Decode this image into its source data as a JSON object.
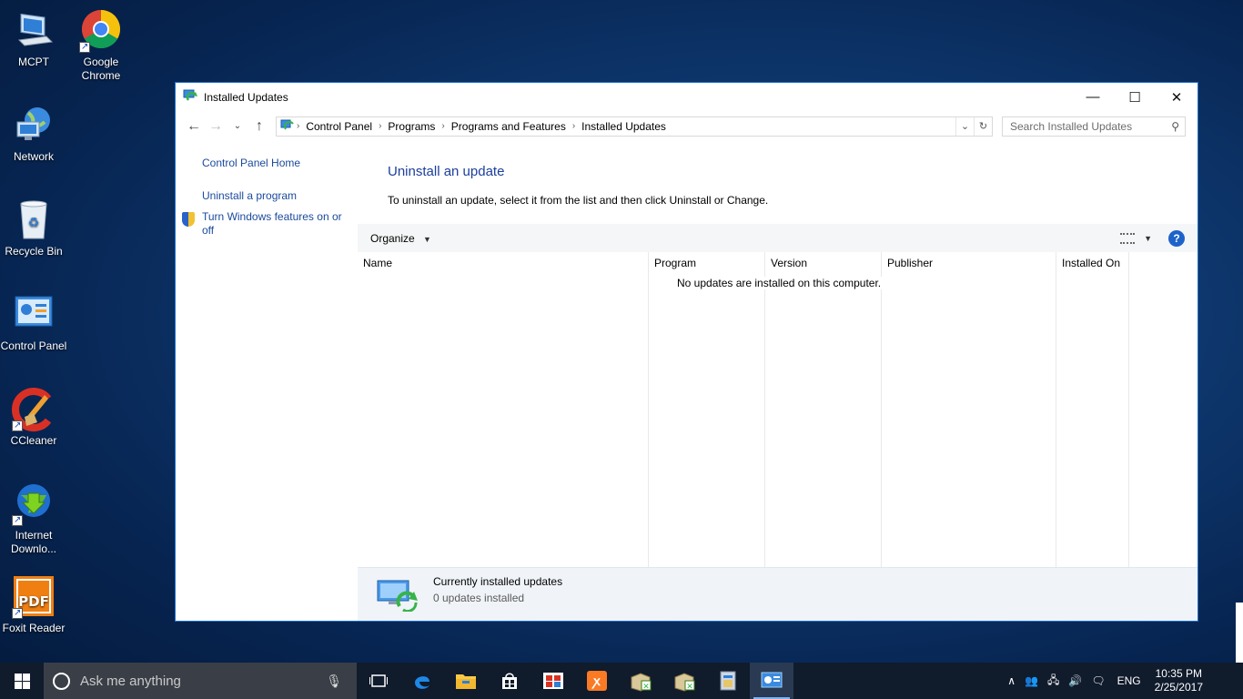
{
  "desktop": {
    "icons": [
      {
        "label": "MCPT"
      },
      {
        "label": "Google Chrome"
      },
      {
        "label": "Network"
      },
      {
        "label": "Recycle Bin"
      },
      {
        "label": "Control Panel"
      },
      {
        "label": "CCleaner"
      },
      {
        "label": "Internet Downlo..."
      },
      {
        "label": "Foxit Reader"
      }
    ]
  },
  "window": {
    "title": "Installed Updates",
    "controls": {
      "minimize": "—",
      "maximize": "☐",
      "close": "✕"
    },
    "breadcrumb": [
      "Control Panel",
      "Programs",
      "Programs and Features",
      "Installed Updates"
    ],
    "search_placeholder": "Search Installed Updates",
    "left_links": {
      "home": "Control Panel Home",
      "uninstall_program": "Uninstall a program",
      "windows_features": "Turn Windows features on or off"
    },
    "heading": "Uninstall an update",
    "instructions": "To uninstall an update, select it from the list and then click Uninstall or Change.",
    "toolbar": {
      "organize": "Organize",
      "help": "?"
    },
    "columns": [
      "Name",
      "Program",
      "Version",
      "Publisher",
      "Installed On"
    ],
    "empty_message": "No updates are installed on this computer.",
    "details": {
      "title": "Currently installed updates",
      "count": "0 updates installed"
    }
  },
  "taskbar": {
    "search_placeholder": "Ask me anything",
    "language": "ENG",
    "time": "10:35 PM",
    "date": "2/25/2017"
  },
  "colors": {
    "accent": "#1d6fcc",
    "link": "#1a4a9c",
    "heading": "#1b3f9a",
    "taskbar": "#101b2c"
  }
}
